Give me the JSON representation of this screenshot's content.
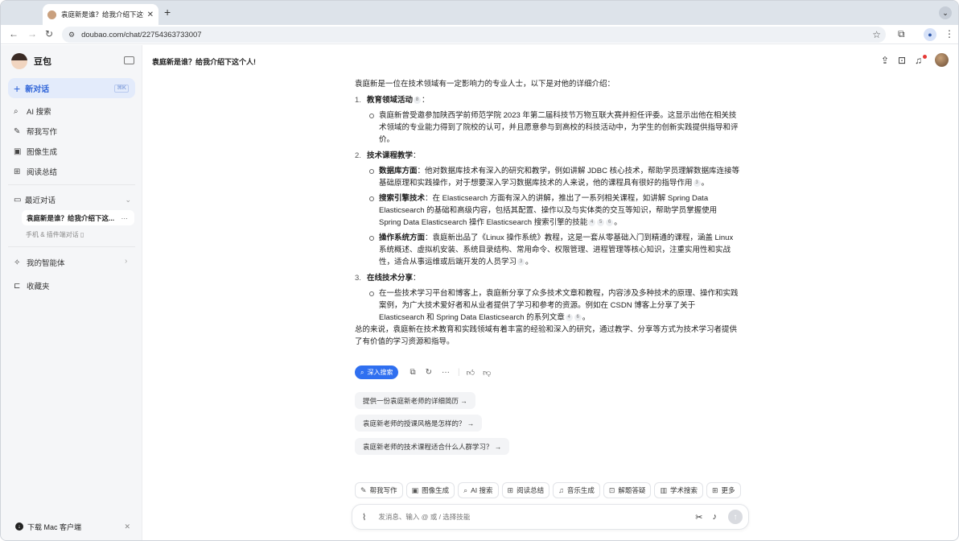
{
  "browser": {
    "tab_title": "袁庭新是谁？给我介绍下这个人",
    "tab_close": "✕",
    "new_tab": "+",
    "tab_menu": "⌄",
    "url": "doubao.com/chat/22754363733007"
  },
  "sidebar": {
    "brand": "豆包",
    "new_chat": "新对话",
    "new_chat_shortcut": "⌘K",
    "items": [
      {
        "icon": "search-icon",
        "glyph": "⌕",
        "label": "AI 搜索"
      },
      {
        "icon": "write-icon",
        "glyph": "✎",
        "label": "帮我写作"
      },
      {
        "icon": "image-icon",
        "glyph": "▣",
        "label": "图像生成"
      },
      {
        "icon": "read-icon",
        "glyph": "⊞",
        "label": "阅读总结"
      }
    ],
    "recent_header": "最近对话",
    "recent_item": "袁庭新是谁？给我介绍下这...",
    "recent_item_more": "···",
    "mobile_note": "手机 & 插件端对话 ▯",
    "agents": "我的智能体",
    "favorites": "收藏夹",
    "download": "下载 Mac 客户端",
    "download_close": "✕"
  },
  "main": {
    "title": "袁庭新是谁？给我介绍下这个人!",
    "intro": "袁庭新是一位在技术领域有一定影响力的专业人士，以下是对他的详细介绍：",
    "sections": [
      {
        "num": "1.",
        "heading": "教育领域活动",
        "cites": [
          "8"
        ],
        "bullets": [
          {
            "bold": "",
            "text": "袁庭新曾受邀参加陕西学前师范学院 2023 年第二届科技节万物互联大赛并担任评委。这显示出他在相关技术领域的专业能力得到了院校的认可，并且愿意参与到高校的科技活动中，为学生的创新实践提供指导和评价。",
            "cites": []
          }
        ]
      },
      {
        "num": "2.",
        "heading": "技术课程教学",
        "cites": [],
        "bullets": [
          {
            "bold": "数据库方面",
            "text": "：他对数据库技术有深入的研究和教学，例如讲解 JDBC 核心技术，帮助学员理解数据库连接等基础原理和实践操作，对于想要深入学习数据库技术的人来说，他的课程具有很好的指导作用",
            "cites": [
              "3"
            ],
            "end": "。"
          },
          {
            "bold": "搜索引擎技术",
            "text": "：在 Elasticsearch 方面有深入的讲解，推出了一系列相关课程，如讲解 Spring Data Elasticsearch 的基础和高级内容，包括其配置、操作以及与实体类的交互等知识，帮助学员掌握使用 Spring Data Elasticsearch 操作 Elasticsearch 搜索引擎的技能",
            "cites": [
              "4",
              "5",
              "6"
            ],
            "end": "。"
          },
          {
            "bold": "操作系统方面",
            "text": "：袁庭新出品了《Linux 操作系统》教程，这是一套从零基础入门到精通的课程，涵盖 Linux 系统概述、虚拟机安装、系统目录结构、常用命令、权限管理、进程管理等核心知识，注重实用性和实战性，适合从事运维或后端开发的人员学习",
            "cites": [
              "3"
            ],
            "end": "。"
          }
        ]
      },
      {
        "num": "3.",
        "heading": "在线技术分享",
        "cites": [],
        "bullets": [
          {
            "bold": "",
            "text": "在一些技术学习平台和博客上，袁庭新分享了众多技术文章和教程，内容涉及多种技术的原理、操作和实践案例，为广大技术爱好者和从业者提供了学习和参考的资源。例如在 CSDN 博客上分享了关于 Elasticsearch 和 Spring Data Elasticsearch 的系列文章",
            "cites": [
              "4",
              "6"
            ],
            "end": "。"
          }
        ]
      }
    ],
    "summary": "总的来说，袁庭新在技术教育和实践领域有着丰富的经验和深入的研究，通过教学、分享等方式为技术学习者提供了有价值的学习资源和指导。",
    "deep_search": "深入搜索",
    "suggestions": [
      "提供一份袁庭新老师的详细简历 →",
      "袁庭新老师的授课风格是怎样的？ →",
      "袁庭新老师的技术课程适合什么人群学习？ →"
    ],
    "skills": [
      {
        "icon": "write-icon",
        "glyph": "✎",
        "label": "帮我写作"
      },
      {
        "icon": "image-icon",
        "glyph": "▣",
        "label": "图像生成"
      },
      {
        "icon": "search-icon",
        "glyph": "⌕",
        "label": "AI 搜索"
      },
      {
        "icon": "read-icon",
        "glyph": "⊞",
        "label": "阅读总结"
      },
      {
        "icon": "music-icon",
        "glyph": "♫",
        "label": "音乐生成"
      },
      {
        "icon": "solve-icon",
        "glyph": "⊡",
        "label": "解题答疑"
      },
      {
        "icon": "academic-icon",
        "glyph": "▥",
        "label": "学术搜索"
      },
      {
        "icon": "more-icon",
        "glyph": "⊞",
        "label": "更多"
      }
    ],
    "input_placeholder": "发消息、输入 @ 或 / 选择技能"
  }
}
